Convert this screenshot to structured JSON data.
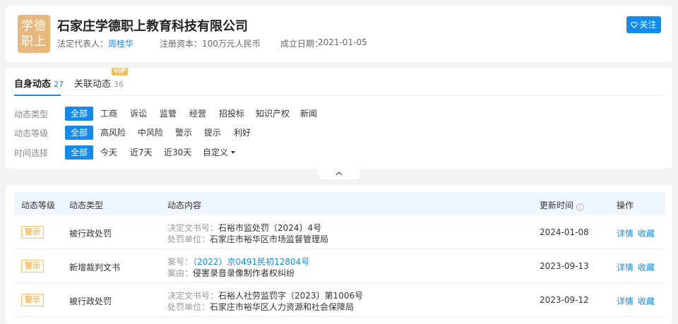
{
  "company": {
    "logo_text": "学德\n职上",
    "name": "石家庄学德职上教育科技有限公司",
    "legal_rep_label": "法定代表人：",
    "legal_rep": "周桂华",
    "capital_label": "注册资本：",
    "capital": "100万元人民币",
    "founded_label": "成立日期：",
    "founded": "2021-01-05",
    "follow_label": "关注"
  },
  "tabs": [
    {
      "label": "自身动态",
      "count": "27"
    },
    {
      "label": "关联动态",
      "count": "36",
      "badge": "VIP"
    }
  ],
  "filters": {
    "type": {
      "label": "动态类型",
      "options": [
        "全部",
        "工商",
        "诉讼",
        "监管",
        "经营",
        "招投标",
        "知识产权",
        "新闻"
      ],
      "selected": "全部"
    },
    "level": {
      "label": "动态等级",
      "options": [
        "全部",
        "高风险",
        "中风险",
        "警示",
        "提示",
        "利好"
      ],
      "selected": "全部"
    },
    "time": {
      "label": "时间选择",
      "options": [
        "全部",
        "今天",
        "近7天",
        "近30天",
        "自定义"
      ],
      "selected": "全部"
    }
  },
  "table": {
    "headers": [
      "动态等级",
      "动态类型",
      "动态内容",
      "更新时间",
      "操作"
    ],
    "rows": [
      {
        "level": "警示",
        "type": "被行政处罚",
        "line1_key": "决定文书号：",
        "line1_val": "石裕市监处罚〔2024〕4号",
        "line2_key": "处罚单位：",
        "line2_val": "石家庄市裕华区市场监督管理局",
        "date": "2024-01-08",
        "op1": "详情",
        "op2": "收藏"
      },
      {
        "level": "警示",
        "type": "新增裁判文书",
        "line1_key": "案号：",
        "line1_val": "（2022）京0491民初12804号",
        "line2_key": "案由：",
        "line2_val": "侵害录音录像制作者权纠纷",
        "date": "2023-09-13",
        "op1": "详情",
        "op2": "收藏"
      },
      {
        "level": "警示",
        "type": "被行政处罚",
        "line1_key": "决定文书号：",
        "line1_val": "石裕人社劳监罚字〔2023〕第1006号",
        "line2_key": "处罚单位：",
        "line2_val": "石家庄市裕华区人力资源和社会保障局",
        "date": "2023-09-12",
        "op1": "详情",
        "op2": "收藏"
      }
    ]
  },
  "colors": {
    "accent": "#128bed",
    "logo_bg": "#e6b87d",
    "warn": "#f0a020"
  },
  "icons": {
    "follow": "heart-outline-icon",
    "collapse": "chevron-up-icon",
    "info": "info-circle-icon",
    "dropdown": "caret-down-icon"
  }
}
